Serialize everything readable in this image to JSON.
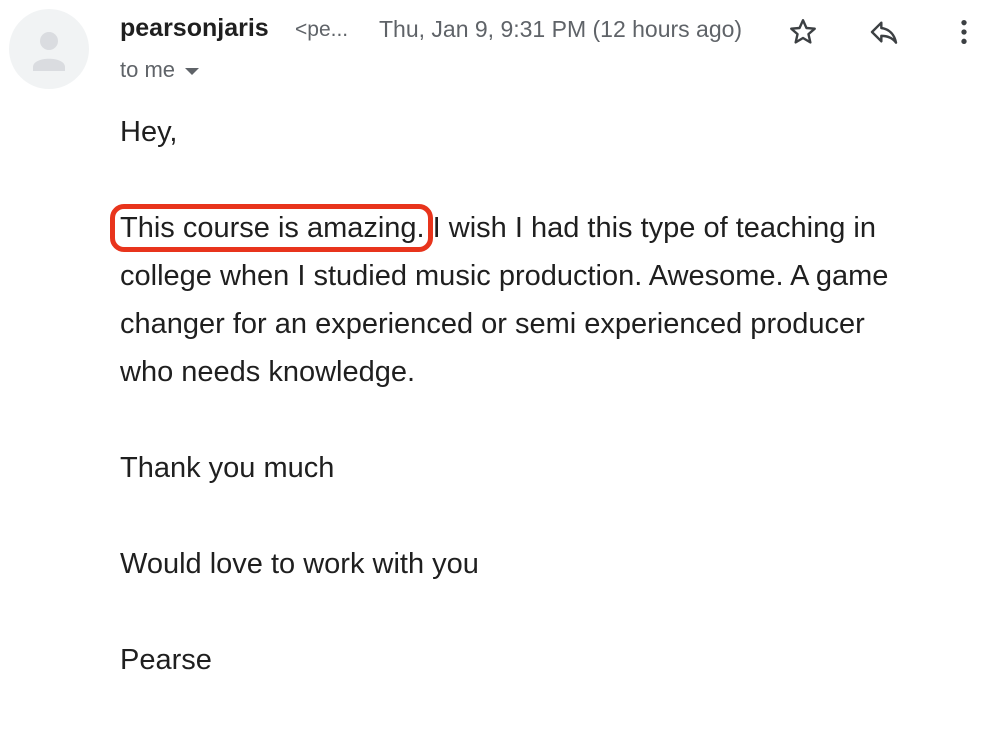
{
  "header": {
    "sender_name": "pearsonjaris",
    "sender_email": "<pe...",
    "timestamp": "Thu, Jan 9, 9:31 PM (12 hours ago)",
    "recipient": "to me",
    "icons": [
      "avatar-placeholder-icon",
      "star-icon",
      "reply-icon",
      "more-vert-icon",
      "chevron-down-icon"
    ]
  },
  "message": {
    "greeting": "Hey,",
    "highlighted_phrase": "This course is amazing.",
    "para1_line1_rest": " I wish I had this type of teaching in",
    "para1_line2": "college when I studied music production. Awesome. A game",
    "para1_line3": "changer for an experienced or semi experienced producer",
    "para1_line4": "who needs knowledge.",
    "thanks": "Thank you much",
    "closing": "Would love to work with you",
    "signature": "Pearse"
  },
  "colors": {
    "highlight_border": "#e8341c",
    "secondary_text": "#5f6368",
    "primary_text": "#1f1f1f"
  }
}
